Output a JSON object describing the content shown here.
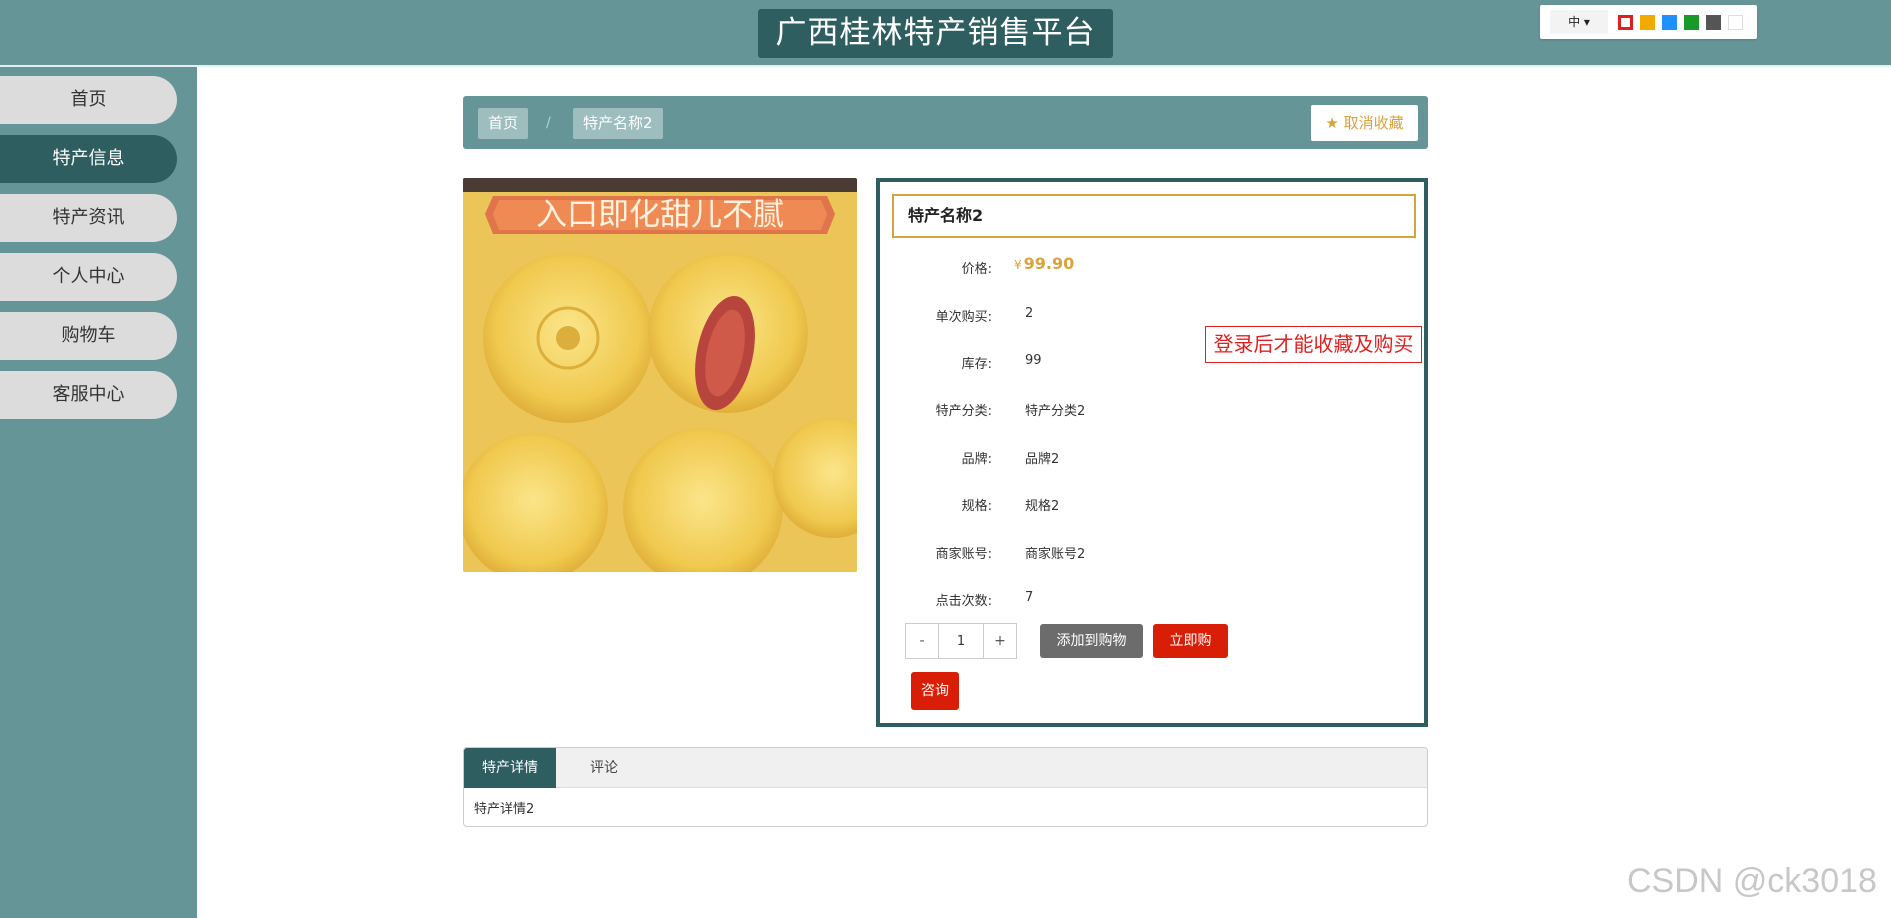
{
  "header": {
    "site_title": "广西桂林特产销售平台",
    "lang_label": "中 ▾",
    "theme_colors": [
      "#e02020",
      "#f2a900",
      "#1e90ff",
      "#189a28",
      "#555555",
      "#ffffff"
    ]
  },
  "sidebar": {
    "items": [
      {
        "label": "首页",
        "active": false
      },
      {
        "label": "特产信息",
        "active": true
      },
      {
        "label": "特产资讯",
        "active": false
      },
      {
        "label": "个人中心",
        "active": false
      },
      {
        "label": "购物车",
        "active": false
      },
      {
        "label": "客服中心",
        "active": false
      }
    ]
  },
  "breadcrumb": {
    "home": "首页",
    "separator": "/",
    "current": "特产名称2",
    "favorite_label": "取消收藏",
    "favorite_icon": "star-icon"
  },
  "product": {
    "image_banner_text": "入口即化甜儿不腻",
    "name": "特产名称2",
    "price_label": "价格:",
    "price_currency": "¥",
    "price": "99.90",
    "rows": [
      {
        "label": "单次购买:",
        "value": "2"
      },
      {
        "label": "库存:",
        "value": "99"
      },
      {
        "label": "特产分类:",
        "value": "特产分类2"
      },
      {
        "label": "品牌:",
        "value": "品牌2"
      },
      {
        "label": "规格:",
        "value": "规格2"
      },
      {
        "label": "商家账号:",
        "value": "商家账号2"
      },
      {
        "label": "点击次数:",
        "value": "7"
      }
    ],
    "login_tip": "登录后才能收藏及购买",
    "quantity": {
      "minus": "-",
      "value": "1",
      "plus": "+"
    },
    "add_to_cart_label": "添加到购物车",
    "buy_now_label": "立即购买",
    "consult_label": "咨询"
  },
  "tabs": {
    "items": [
      "特产详情",
      "评论"
    ],
    "active_index": 0,
    "content": "特产详情2"
  },
  "watermark": "CSDN @ck3018"
}
